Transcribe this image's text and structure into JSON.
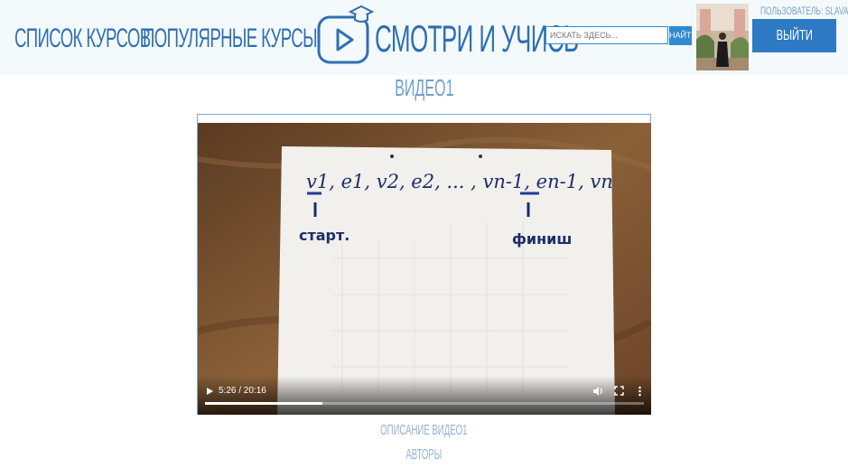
{
  "header": {
    "nav": [
      {
        "label": "СПИСОК КУРСОВ"
      },
      {
        "label": "ПОПУЛЯРНЫЕ КУРСЫ"
      }
    ],
    "logo_text": "СМОТРИ И УЧИСЬ",
    "search": {
      "placeholder": "ИСКАТЬ ЗДЕСЬ...",
      "button_label": "НАЙТИ"
    },
    "user_label": "ПОЛЬЗОВАТЕЛЬ: SLAVA",
    "logout_label": "ВЫЙТИ"
  },
  "video": {
    "title": "ВИДЕО1",
    "time": "5:26 / 20:16",
    "progress": 0.268,
    "board": {
      "sequence": "v1, e1, v2, e2, ... , vn-1, en-1, vn",
      "start_label": "старт.",
      "finish_label": "финиш"
    }
  },
  "footer": {
    "description_link": "ОПИСАНИЕ ВИДЕО1",
    "authors_link": "АВТОРЫ"
  },
  "colors": {
    "accent": "#2f6fb3",
    "button": "#2e7ac4",
    "header_bg": "#f4fafc"
  }
}
